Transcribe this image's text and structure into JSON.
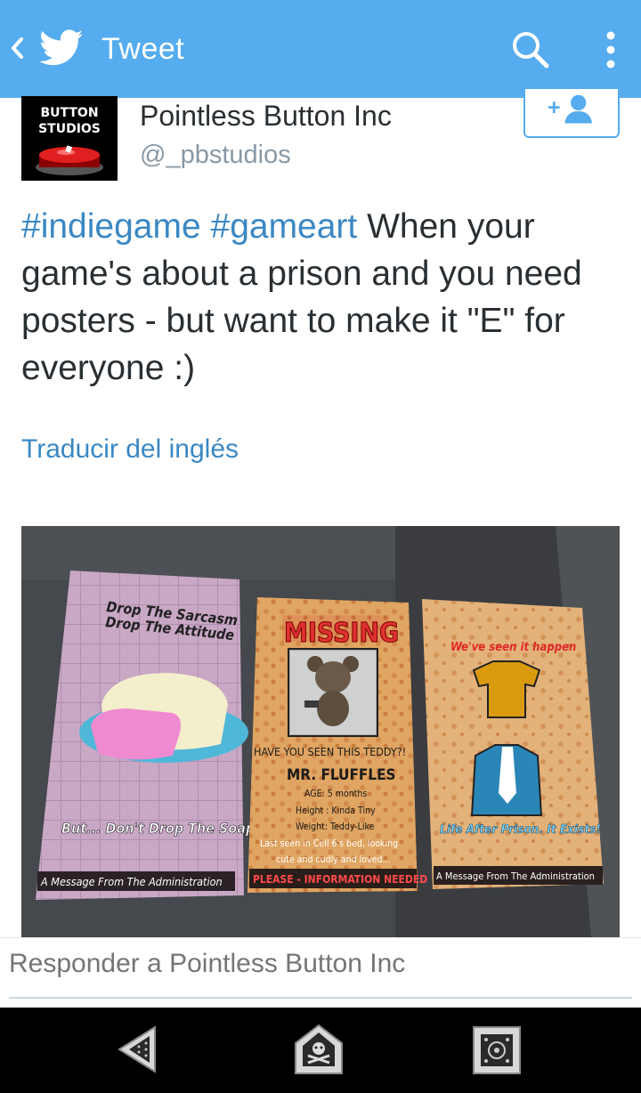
{
  "appbar": {
    "title": "Tweet",
    "back_icon": "chevron-left-icon",
    "brand_icon": "twitter-bird-icon",
    "search_icon": "search-icon",
    "overflow_icon": "more-vertical-icon",
    "color": "#55acee"
  },
  "author": {
    "name": "Pointless Button Inc",
    "handle": "@_pbstudios",
    "avatar_text_line1": "BUTTON",
    "avatar_text_line2": "STUDIOS",
    "follow_icon": "add-user-icon"
  },
  "tweet": {
    "hashtag1": "#indiegame",
    "hashtag2": "#gameart",
    "body": " When your game's about a prison and you need posters - but want to make it \"E\" for everyone :)",
    "translate_label": "Traducir del inglés"
  },
  "media": {
    "poster1": {
      "line1": "Drop The Sarcasm",
      "line2": "Drop The Attitude",
      "line3": "But... Don't Drop The Soap",
      "footer": "A Message From The Administration"
    },
    "poster2": {
      "heading": "MISSING",
      "question": "HAVE YOU SEEN THIS TEDDY?!",
      "name": "MR. FLUFFLES",
      "age": "AGE: 5 months",
      "height": "Height : Kinda Tiny",
      "weight": "Weight: Teddy-Like",
      "seen1": "Last seen in Cell 6's bed, looking",
      "seen2": "cute and cudly and loved...",
      "footer": "PLEASE - INFORMATION NEEDED"
    },
    "poster3": {
      "heading": "We've seen it happen",
      "tagline": "Life After Prison. It Exists!",
      "footer": "A Message From The Administration"
    }
  },
  "reply": {
    "placeholder": "Responder a Pointless Button Inc"
  },
  "navbar": {
    "back_icon": "nav-back-icon",
    "home_icon": "nav-home-icon",
    "recents_icon": "nav-recents-icon"
  }
}
